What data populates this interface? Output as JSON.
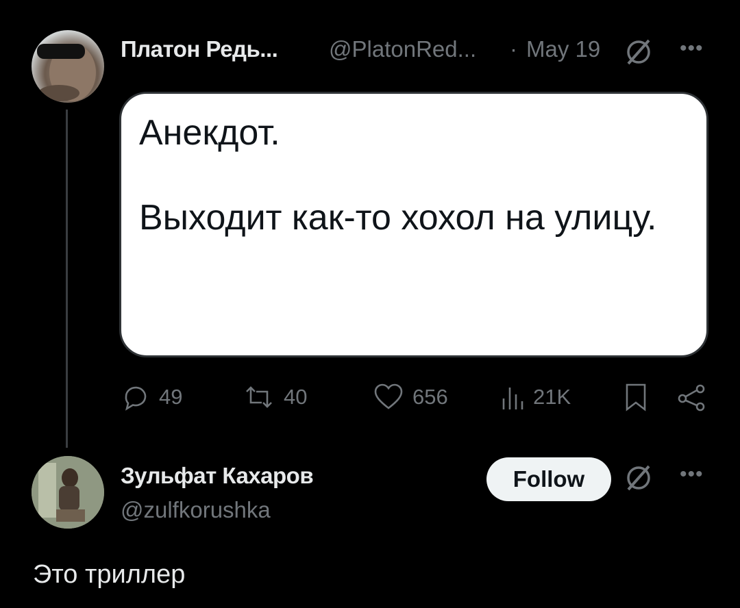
{
  "tweet": {
    "author_name": "Платон Редь...",
    "author_handle": "@PlatonRed...",
    "separator": "·",
    "date": "May 19",
    "card_text": "Анекдот.\n\nВыходит как-то хохол на улицу."
  },
  "actions": {
    "replies": "49",
    "retweets": "40",
    "likes": "656",
    "views": "21K"
  },
  "reply": {
    "author_name": "Зульфат Кахаров",
    "author_handle": "@zulfkorushka",
    "follow_label": "Follow",
    "text": "Это триллер"
  },
  "colors": {
    "background": "#000000",
    "text": "#e7e9ea",
    "muted": "#71767b",
    "card": "#ffffff",
    "follow_button": "#eff3f4"
  }
}
